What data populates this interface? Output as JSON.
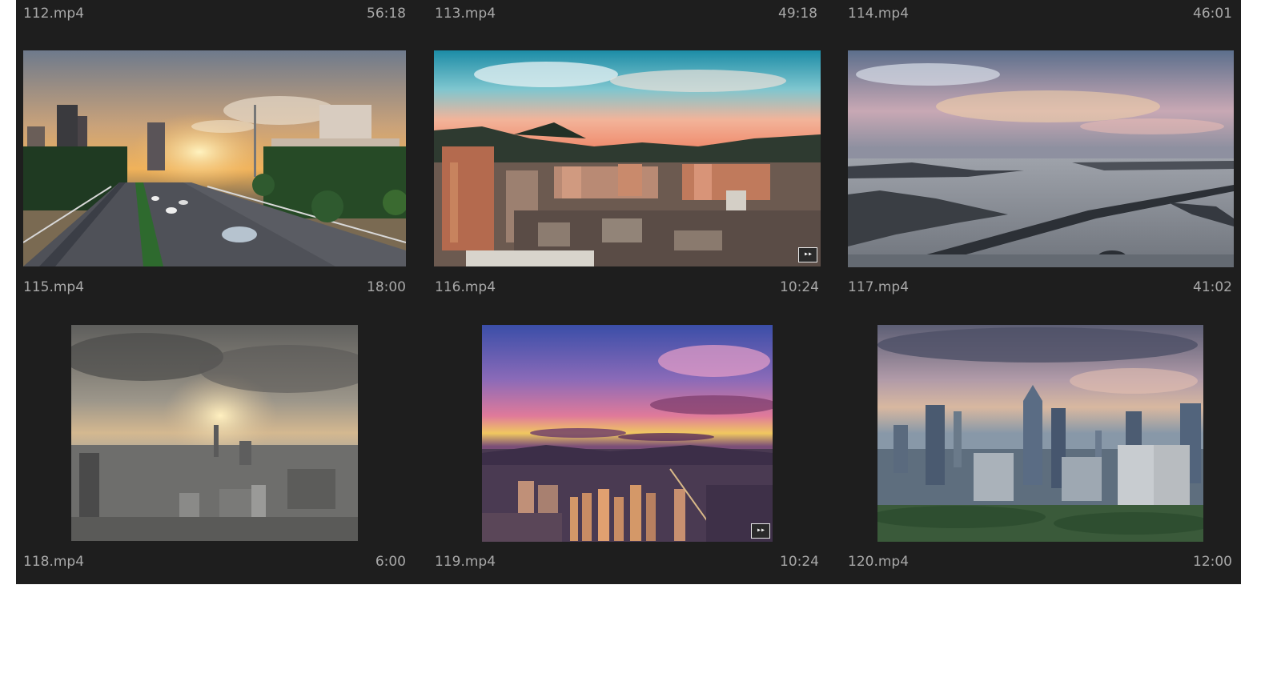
{
  "top_row": [
    {
      "name": "112.mp4",
      "duration": "56:18"
    },
    {
      "name": "113.mp4",
      "duration": "49:18"
    },
    {
      "name": "114.mp4",
      "duration": "46:01"
    }
  ],
  "clips": [
    {
      "name": "115.mp4",
      "duration": "18:00",
      "scene": "highway at sunset with city buildings"
    },
    {
      "name": "116.mp4",
      "duration": "10:24",
      "scene": "dense city with mountains under pink sky"
    },
    {
      "name": "117.mp4",
      "duration": "41:02",
      "scene": "aerial lake with causeway bridge at dusk"
    },
    {
      "name": "118.mp4",
      "duration": "6:00",
      "scene": "hazy skyline under cloudy sunset"
    },
    {
      "name": "119.mp4",
      "duration": "10:24",
      "scene": "purple sunset over city aerial"
    },
    {
      "name": "120.mp4",
      "duration": "12:00",
      "scene": "skyline with skyscrapers at dusk"
    }
  ],
  "badge_icon": "merged-clip-icon",
  "badge_glyph": "▸▸"
}
